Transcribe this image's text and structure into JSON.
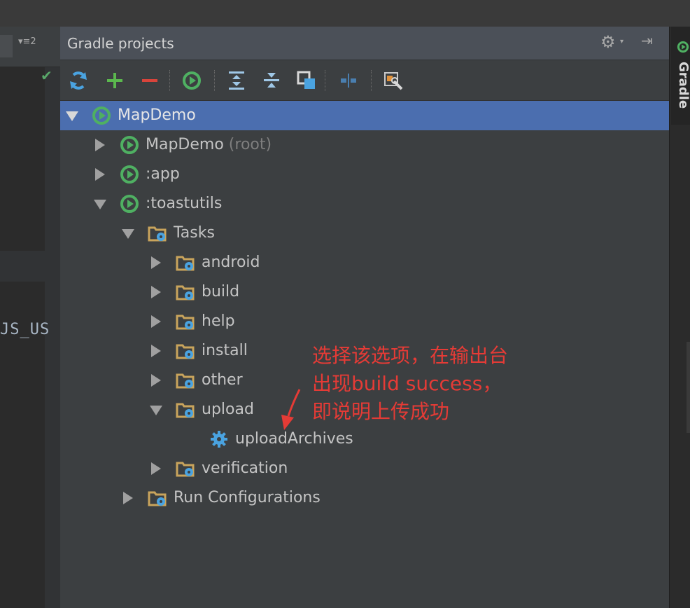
{
  "editor": {
    "tab_menu": "▾≡2",
    "code_fragment": "JS_US"
  },
  "panel": {
    "title": "Gradle projects"
  },
  "toolbar": {
    "buttons": [
      {
        "name": "refresh-all-projects-button",
        "icon": "refresh-icon"
      },
      {
        "name": "add-project-button",
        "icon": "plus-icon"
      },
      {
        "name": "remove-project-button",
        "icon": "minus-icon"
      },
      {
        "name": "execute-gradle-task-button",
        "icon": "gradle-run-icon"
      },
      {
        "name": "expand-all-button",
        "icon": "expand-all-icon"
      },
      {
        "name": "collapse-all-button",
        "icon": "collapse-all-icon"
      },
      {
        "name": "attach-project-button",
        "icon": "attach-icon"
      },
      {
        "name": "toggle-offline-mode-button",
        "icon": "offline-icon"
      },
      {
        "name": "gradle-settings-button",
        "icon": "settings-icon"
      }
    ]
  },
  "tree": {
    "rows": [
      {
        "label": "MapDemo",
        "suffix": "",
        "icon": "gradle-icon",
        "expanded": true,
        "selected": true
      },
      {
        "label": "MapDemo",
        "suffix": "(root)",
        "icon": "gradle-icon",
        "expanded": false
      },
      {
        "label": ":app",
        "suffix": "",
        "icon": "gradle-icon",
        "expanded": false
      },
      {
        "label": ":toastutils",
        "suffix": "",
        "icon": "gradle-icon",
        "expanded": true
      },
      {
        "label": "Tasks",
        "suffix": "",
        "icon": "task-folder-icon",
        "expanded": true
      },
      {
        "label": "android",
        "suffix": "",
        "icon": "task-folder-icon",
        "expanded": false
      },
      {
        "label": "build",
        "suffix": "",
        "icon": "task-folder-icon",
        "expanded": false
      },
      {
        "label": "help",
        "suffix": "",
        "icon": "task-folder-icon",
        "expanded": false
      },
      {
        "label": "install",
        "suffix": "",
        "icon": "task-folder-icon",
        "expanded": false
      },
      {
        "label": "other",
        "suffix": "",
        "icon": "task-folder-icon",
        "expanded": false
      },
      {
        "label": "upload",
        "suffix": "",
        "icon": "task-folder-icon",
        "expanded": true
      },
      {
        "label": "uploadArchives",
        "suffix": "",
        "icon": "gear-icon",
        "leaf": true
      },
      {
        "label": "verification",
        "suffix": "",
        "icon": "task-folder-icon",
        "expanded": false
      },
      {
        "label": "Run Configurations",
        "suffix": "",
        "icon": "task-folder-icon",
        "expanded": false
      }
    ]
  },
  "right_tab": {
    "label": "Gradle"
  },
  "annotation": {
    "lines": [
      "选择该选项，在输出台",
      "出现build success，",
      "即说明上传成功"
    ],
    "color": "#e53b36"
  }
}
